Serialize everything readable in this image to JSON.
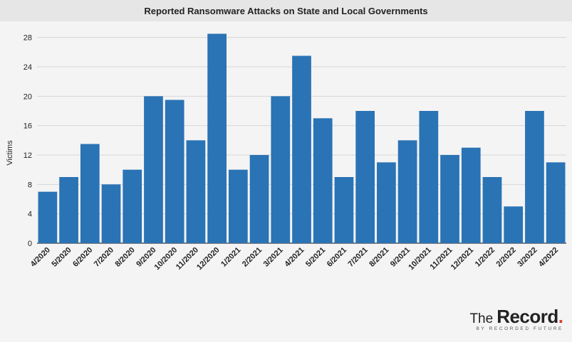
{
  "header": {
    "title": "Reported Ransomware Attacks on State and Local Governments"
  },
  "brand": {
    "prefix": "The",
    "name": "Record",
    "dot": ".",
    "tagline": "BY RECORDED FUTURE"
  },
  "chart_data": {
    "type": "bar",
    "title": "Reported Ransomware Attacks on State and Local Governments",
    "xlabel": "",
    "ylabel": "Victims",
    "ylim": [
      0,
      30
    ],
    "yticks": [
      0,
      4,
      8,
      12,
      16,
      20,
      24,
      28
    ],
    "grid": true,
    "bar_color": "#2a73b5",
    "categories": [
      "4/2020",
      "5/2020",
      "6/2020",
      "7/2020",
      "8/2020",
      "9/2020",
      "10/2020",
      "11/2020",
      "12/2020",
      "1/2021",
      "2/2021",
      "3/2021",
      "4/2021",
      "5/2021",
      "6/2021",
      "7/2021",
      "8/2021",
      "9/2021",
      "10/2021",
      "11/2021",
      "12/2021",
      "1/2022",
      "2/2022",
      "3/2022",
      "4/2022"
    ],
    "values": [
      7,
      9,
      13.5,
      8,
      10,
      20,
      19.5,
      14,
      28.5,
      10,
      12,
      20,
      25.5,
      17,
      9,
      18,
      11,
      14,
      18,
      12,
      13,
      9,
      5,
      18,
      11
    ]
  }
}
